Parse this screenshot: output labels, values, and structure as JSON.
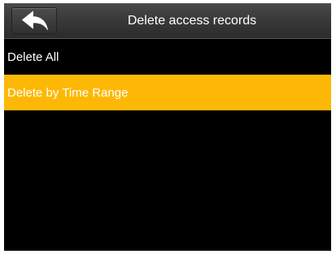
{
  "header": {
    "title": "Delete access records",
    "back_icon": "back-arrow-icon"
  },
  "menu": {
    "items": [
      {
        "label": "Delete All",
        "selected": false
      },
      {
        "label": "Delete by Time Range",
        "selected": true
      }
    ]
  },
  "colors": {
    "background": "#000000",
    "highlight": "#fdb805",
    "text": "#ffffff"
  }
}
